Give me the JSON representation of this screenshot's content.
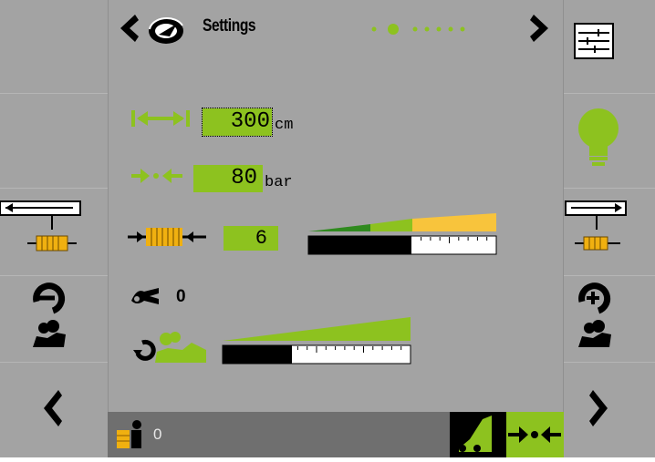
{
  "header": {
    "title": "Settings",
    "page_dots": 7,
    "active_dot": 1
  },
  "settings": {
    "width_value": "300",
    "width_unit": "cm",
    "pressure_value": "80",
    "pressure_unit": "bar",
    "level_value": "6",
    "level_bar_fraction": 0.55,
    "counter_value": "0",
    "rotation_bar_fraction": 0.37
  },
  "footer": {
    "counter_value": "0"
  },
  "colors": {
    "screen_bg": "#a3a3a3",
    "accent_green": "#8dc21f",
    "dark_green": "#2f8a1e",
    "yellow": "#f8c43c",
    "bottom_bar": "#6f6f6f"
  },
  "icons": {
    "back": "chevron-left-icon",
    "next": "chevron-right-icon",
    "speedometer": "speedometer-icon",
    "menu": "settings-sliders-icon",
    "light": "lightbulb-icon"
  }
}
